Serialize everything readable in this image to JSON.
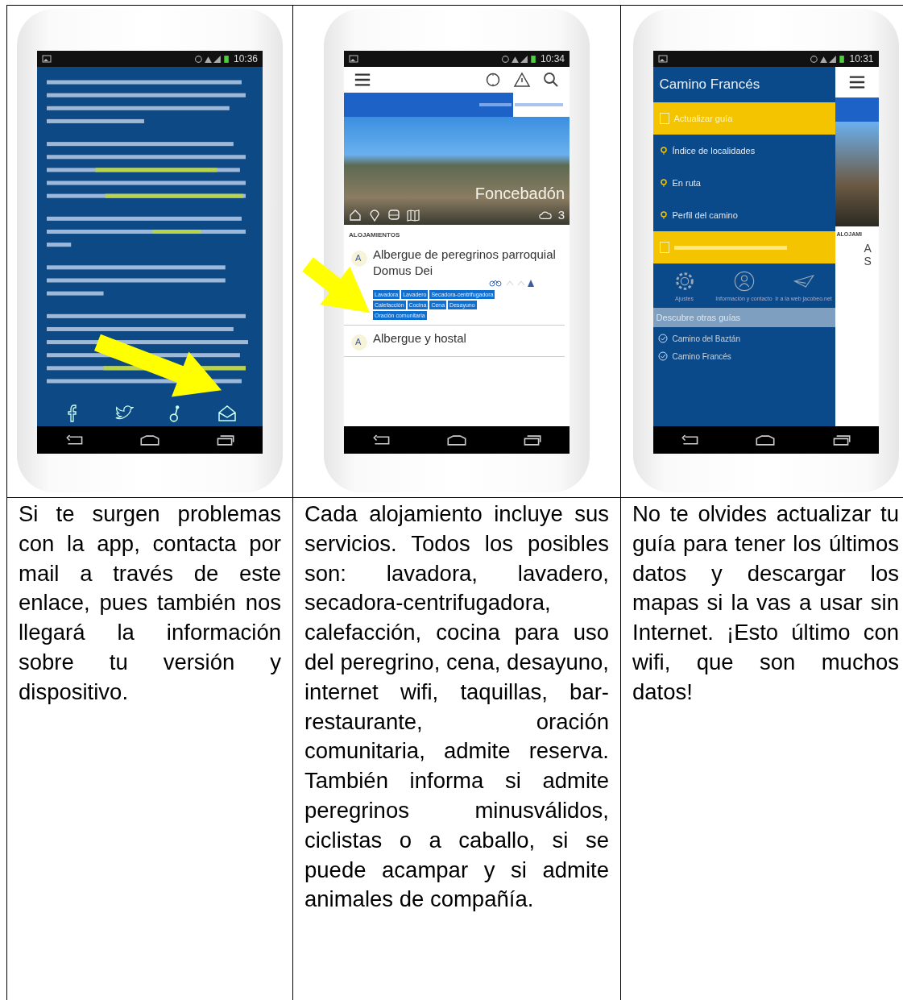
{
  "columns": [
    {
      "phone": {
        "kind": "about",
        "time": "10:36"
      },
      "caption": "Si te surgen problemas con la app, contacta por mail a través de este enlace, pues también nos llegará la información sobre tu versión y dispositivo."
    },
    {
      "phone": {
        "kind": "listing",
        "time": "10:34",
        "place": "Foncebadón",
        "weather": "3",
        "section": "ALOJAMIENTOS",
        "lodgings": [
          {
            "badge": "A",
            "name": "Albergue de peregrinos parroquial Domus Dei",
            "services": [
              "Lavadora",
              "Lavadero",
              "Secadora-centrifugadora",
              "Calefacción",
              "Cocina",
              "Cena",
              "Desayuno",
              "Oración comunitaria"
            ]
          },
          {
            "badge": "A",
            "name": "Albergue y hostal"
          }
        ]
      },
      "caption": "Cada alojamiento incluye sus servicios. Todos los posibles son: lavadora, lavadero, secadora-centrifugadora, calefacción, cocina para uso del peregrino, cena, desayuno, internet wifi, taquillas, bar-restaurante, oración comunitaria, admite reserva. También informa si admite peregrinos minusválidos, ciclistas o a caballo, si se puede acampar y si admite animales de compañía."
    },
    {
      "phone": {
        "kind": "menu",
        "time": "10:31",
        "title": "Camino Francés",
        "items": [
          {
            "kind": "highlight",
            "label": "Actualizar guía"
          },
          {
            "kind": "normal",
            "label": "Índice de localidades"
          },
          {
            "kind": "normal",
            "label": "En ruta"
          },
          {
            "kind": "normal",
            "label": "Perfil del camino"
          },
          {
            "kind": "highlight"
          }
        ],
        "actions": [
          {
            "kind": "settings",
            "label": "Ajustes"
          },
          {
            "kind": "info",
            "label": "Información y contacto"
          },
          {
            "kind": "web",
            "label": "Ir a la web jacobeo.net"
          }
        ],
        "guides_title": "Descubre otras guías",
        "guides": [
          "Camino del Baztán",
          "Camino Francés"
        ],
        "behind": {
          "section": "ALOJAMI",
          "letters": [
            "A",
            "S"
          ]
        }
      },
      "caption": "No te olvides actualizar tu guía para tener los últimos datos y descargar los mapas si la vas a usar sin Internet. ¡Esto último con wifi, que son muchos datos!"
    }
  ]
}
